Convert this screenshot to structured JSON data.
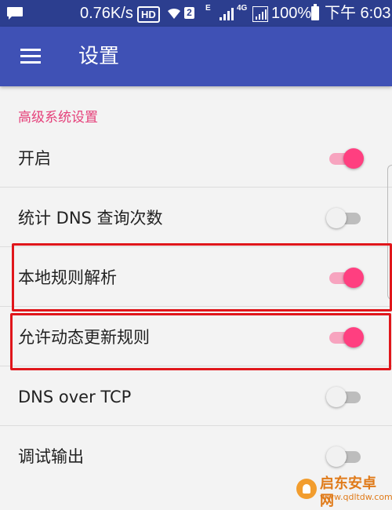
{
  "status_bar": {
    "speed": "0.76K/s",
    "hd": "HD",
    "sim": "2",
    "e_label": "E",
    "network": "4G",
    "battery": "100%",
    "time": "下午 6:03",
    "background": "#2c3e8f"
  },
  "toolbar": {
    "title": "设置",
    "background": "#3f51b5"
  },
  "settings": {
    "category": "高级系统设置",
    "accent": "#ff3f80",
    "items": [
      {
        "label": "开启",
        "enabled": true
      },
      {
        "label": "统计 DNS 查询次数",
        "enabled": false
      },
      {
        "label": "本地规则解析",
        "enabled": true
      },
      {
        "label": "允许动态更新规则",
        "enabled": true
      },
      {
        "label": "DNS over TCP",
        "enabled": false
      },
      {
        "label": "调试输出",
        "enabled": false
      }
    ]
  },
  "highlight_color": "#e0161b",
  "watermark": {
    "name": "启东安卓网",
    "url": "www.qdltdw.com"
  }
}
